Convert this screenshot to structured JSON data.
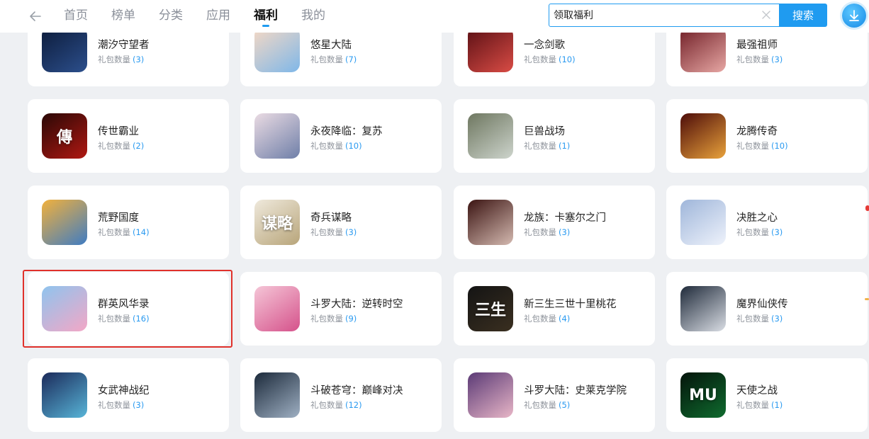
{
  "nav": {
    "tabs": [
      {
        "label": "首页",
        "active": false
      },
      {
        "label": "榜单",
        "active": false
      },
      {
        "label": "分类",
        "active": false
      },
      {
        "label": "应用",
        "active": false
      },
      {
        "label": "福利",
        "active": true
      },
      {
        "label": "我的",
        "active": false
      }
    ]
  },
  "search": {
    "value": "领取福利",
    "button_label": "搜索"
  },
  "colors": {
    "accent": "#1f9bf0",
    "count_text": "#2a9af0",
    "highlight": "#e0312b",
    "background": "#eef0f3"
  },
  "gift_label": "礼包数量",
  "games": [
    {
      "name": "潮汐守望者",
      "count": "(3)",
      "icon": "ringed-planet-icon",
      "colors": [
        "#0c1b3a",
        "#2c4f8c"
      ],
      "glyph": ""
    },
    {
      "name": "悠星大陆",
      "count": "(7)",
      "icon": "anime-girl-icon",
      "colors": [
        "#f6d9c4",
        "#7fb7e8"
      ],
      "glyph": ""
    },
    {
      "name": "一念剑歌",
      "count": "(10)",
      "icon": "lady-portrait-icon",
      "colors": [
        "#5a0f14",
        "#d94c45"
      ],
      "glyph": ""
    },
    {
      "name": "最强祖师",
      "count": "(3)",
      "icon": "red-hair-girl-icon",
      "colors": [
        "#6f1d25",
        "#e7a7a4"
      ],
      "glyph": ""
    },
    {
      "name": "传世霸业",
      "count": "(2)",
      "icon": "calligraphy-logo-icon",
      "colors": [
        "#2a0806",
        "#b01812"
      ],
      "glyph": "傳"
    },
    {
      "name": "永夜降临：复苏",
      "count": "(10)",
      "icon": "maid-girl-icon",
      "colors": [
        "#eadbe3",
        "#6f7fa8"
      ],
      "glyph": ""
    },
    {
      "name": "巨兽战场",
      "count": "(1)",
      "icon": "dinosaur-icon",
      "colors": [
        "#6e7760",
        "#cdd4cc"
      ],
      "glyph": ""
    },
    {
      "name": "龙腾传奇",
      "count": "(10)",
      "icon": "dragon-icon",
      "colors": [
        "#4d0c09",
        "#e9a23b"
      ],
      "glyph": ""
    },
    {
      "name": "荒野国度",
      "count": "(14)",
      "icon": "cat-hero-icon",
      "colors": [
        "#f2b13c",
        "#3f7cc2"
      ],
      "glyph": ""
    },
    {
      "name": "奇兵谋略",
      "count": "(3)",
      "icon": "strategy-logo-icon",
      "colors": [
        "#efe9dc",
        "#b8a57a"
      ],
      "glyph": "谋略"
    },
    {
      "name": "龙族：卡塞尔之门",
      "count": "(3)",
      "icon": "red-dress-girl-icon",
      "colors": [
        "#3b1412",
        "#d4b9b0"
      ],
      "glyph": ""
    },
    {
      "name": "决胜之心",
      "count": "(3)",
      "icon": "silver-hair-girl-icon",
      "colors": [
        "#9fb6da",
        "#eef2fb"
      ],
      "glyph": ""
    },
    {
      "name": "群英风华录",
      "count": "(16)",
      "icon": "pink-hair-girl-icon",
      "colors": [
        "#8fc4ee",
        "#f3a7c6"
      ],
      "glyph": ""
    },
    {
      "name": "斗罗大陆：逆转时空",
      "count": "(9)",
      "icon": "pink-girl-icon",
      "colors": [
        "#f5c6d7",
        "#d5528b"
      ],
      "glyph": ""
    },
    {
      "name": "新三生三世十里桃花",
      "count": "(4)",
      "icon": "gold-calligraphy-icon",
      "colors": [
        "#141414",
        "#3a2f20"
      ],
      "glyph": "三生"
    },
    {
      "name": "魔界仙侠传",
      "count": "(3)",
      "icon": "warrior-icon",
      "colors": [
        "#1f2a3a",
        "#d9dde4"
      ],
      "glyph": ""
    },
    {
      "name": "女武神战纪",
      "count": "(3)",
      "icon": "valkyrie-icon",
      "colors": [
        "#1b2a5a",
        "#58b5d8"
      ],
      "glyph": ""
    },
    {
      "name": "斗破苍穹：巅峰对决",
      "count": "(12)",
      "icon": "swordsman-icon",
      "colors": [
        "#1c2a3b",
        "#9fb0c3"
      ],
      "glyph": ""
    },
    {
      "name": "斗罗大陆：史莱克学院",
      "count": "(5)",
      "icon": "purple-girl-icon",
      "colors": [
        "#5b3a76",
        "#e8b6c7"
      ],
      "glyph": ""
    },
    {
      "name": "天使之战",
      "count": "(1)",
      "icon": "mu-logo-icon",
      "colors": [
        "#04140b",
        "#0f6b2e"
      ],
      "glyph": "MU"
    }
  ]
}
